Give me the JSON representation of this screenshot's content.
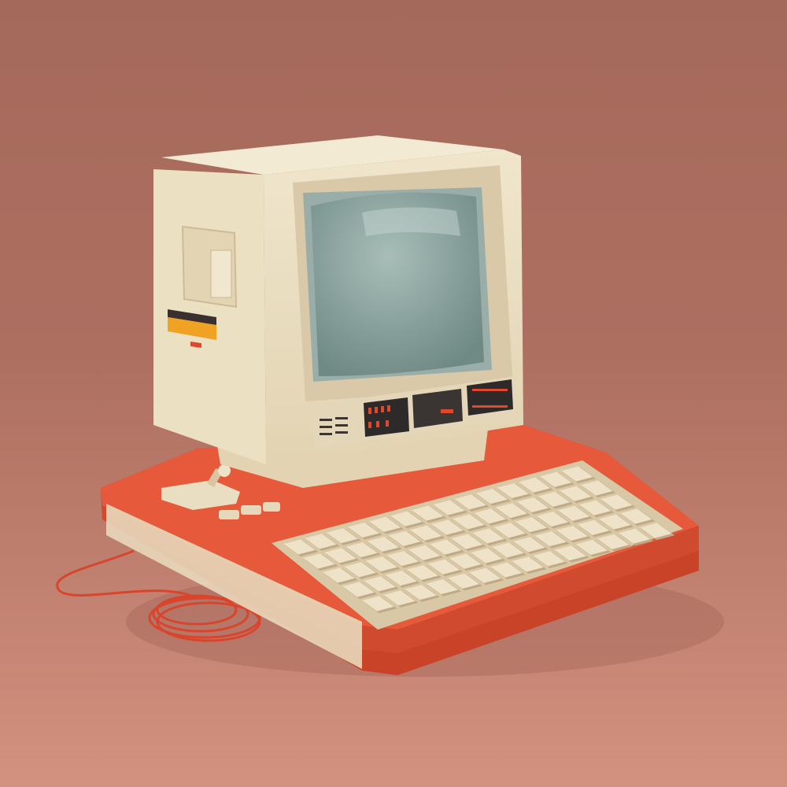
{
  "scene": {
    "subject": "retro-computer",
    "colors": {
      "background_top": "#a5695b",
      "background_bottom": "#d3917f",
      "case_cream": "#efe3c6",
      "case_shadow": "#d8c6a2",
      "screen": "#8fa7a3",
      "base_orange": "#e0573a",
      "key_cream": "#eee2c8",
      "indicator_red": "#e0482c",
      "stripe_orange": "#f0a224"
    },
    "keyboard": {
      "rows": 5,
      "cols": 14
    }
  }
}
